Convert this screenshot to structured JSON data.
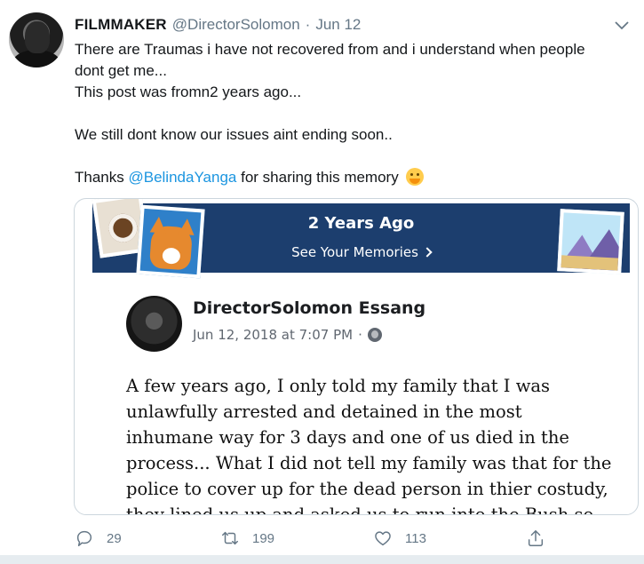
{
  "tweet": {
    "display_name": "FILMMAKER",
    "handle": "@DirectorSolomon",
    "separator": "·",
    "date": "Jun 12",
    "text": {
      "line1": "There are Traumas i have not recovered from and i understand when people",
      "line2": "dont get me...",
      "line3": "This post was fromn2 years ago...",
      "line4": "We still dont know our issues aint ending soon..",
      "thanks_prefix": "Thanks",
      "mention": "@BelindaYanga",
      "thanks_suffix": "for sharing this memory"
    },
    "emoji": "hugging-face-emoji"
  },
  "memory_card": {
    "banner_title": "2 Years Ago",
    "banner_link": "See Your Memories",
    "post_author": "DirectorSolomon Essang",
    "post_date": "Jun 12, 2018 at 7:07 PM",
    "post_date_sep": "·",
    "post_lines": [
      "A few years ago, I only told my family that I was",
      "unlawfully arrested and detained in the most",
      "inhumane way for 3 days and one of us died in the",
      "process... What I did not tell my family was that for the",
      "police to cover up for the dead person in thier costudy,",
      "they lined us up and asked us to run into the Bush so"
    ]
  },
  "actions": {
    "reply_count": "29",
    "retweet_count": "199",
    "like_count": "113"
  },
  "colors": {
    "link": "#1b95e0",
    "muted": "#657786",
    "banner": "#1c3e6e"
  }
}
